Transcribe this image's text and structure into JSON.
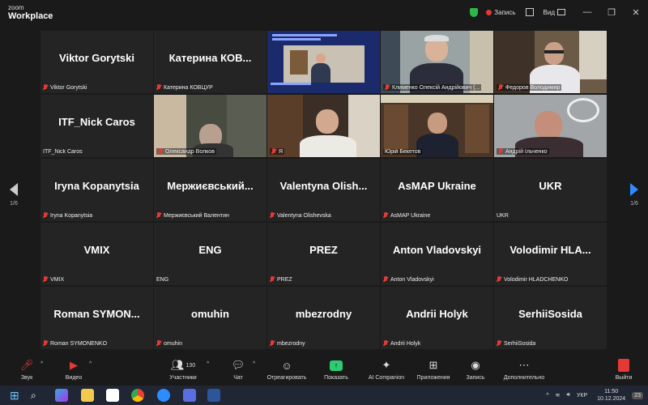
{
  "titlebar": {
    "logo_line1": "zoom",
    "logo_line2": "Workplace",
    "record_label": "Запись",
    "view_label": "Вид"
  },
  "nav": {
    "left_page": "1/6",
    "right_page": "1/6"
  },
  "tiles": [
    {
      "big": "Viktor Gorytski",
      "small": "Viktor Gorytski"
    },
    {
      "big": "Катерина  КОВ...",
      "small": "Катерина КОВЦУР"
    },
    {
      "big": "",
      "small": ""
    },
    {
      "big": "",
      "small": "Клименко Олексій Андрійович (..."
    },
    {
      "big": "",
      "small": "Федоров Володимир"
    },
    {
      "big": "ITF_Nick Caros",
      "small": "ITF_Nick Caros"
    },
    {
      "big": "",
      "small": "Олександр Волков"
    },
    {
      "big": "",
      "small": "Я"
    },
    {
      "big": "",
      "small": "Юрій Бекетов"
    },
    {
      "big": "",
      "small": "Андрій Ільченко"
    },
    {
      "big": "Iryna Kopanytsia",
      "small": "Iryna Kopanytsia"
    },
    {
      "big": "Мержиєвський...",
      "small": "Мержиєвський Валентин"
    },
    {
      "big": "Valentyna  Olish...",
      "small": "Valentyna Olishevska"
    },
    {
      "big": "AsMAP Ukraine",
      "small": "AsMAP Ukraine"
    },
    {
      "big": "UKR",
      "small": "UKR"
    },
    {
      "big": "VMIX",
      "small": "VMIX"
    },
    {
      "big": "ENG",
      "small": "ENG"
    },
    {
      "big": "PREZ",
      "small": "PREZ"
    },
    {
      "big": "Anton Vladovskyi",
      "small": "Anton Vladovskyi"
    },
    {
      "big": "Volodimir  HLA...",
      "small": "Volodimir HLADCHENKO"
    },
    {
      "big": "Roman  SYMON...",
      "small": "Roman SYMONENKO"
    },
    {
      "big": "omuhin",
      "small": "omuhin"
    },
    {
      "big": "mbezrodny",
      "small": "mbezrodny"
    },
    {
      "big": "Andrii Holyk",
      "small": "Andrii Holyk"
    },
    {
      "big": "SerhiiSosida",
      "small": "SerhiiSosida"
    }
  ],
  "toolbar": {
    "audio": "Звук",
    "video": "Видео",
    "participants": "Участники",
    "participants_count": "130",
    "chat": "Чат",
    "react": "Отреагировать",
    "share": "Показать",
    "ai": "AI Companion",
    "apps": "Приложения",
    "record": "Запись",
    "more": "Дополнительно",
    "leave": "Выйти"
  },
  "taskbar": {
    "lang": "УКР",
    "time": "11:50",
    "date": "10.12.2024",
    "notifications": "23"
  },
  "colors": {
    "active_speaker": "#2ecc71",
    "muted": "#e53935",
    "accent": "#2d8cff"
  }
}
